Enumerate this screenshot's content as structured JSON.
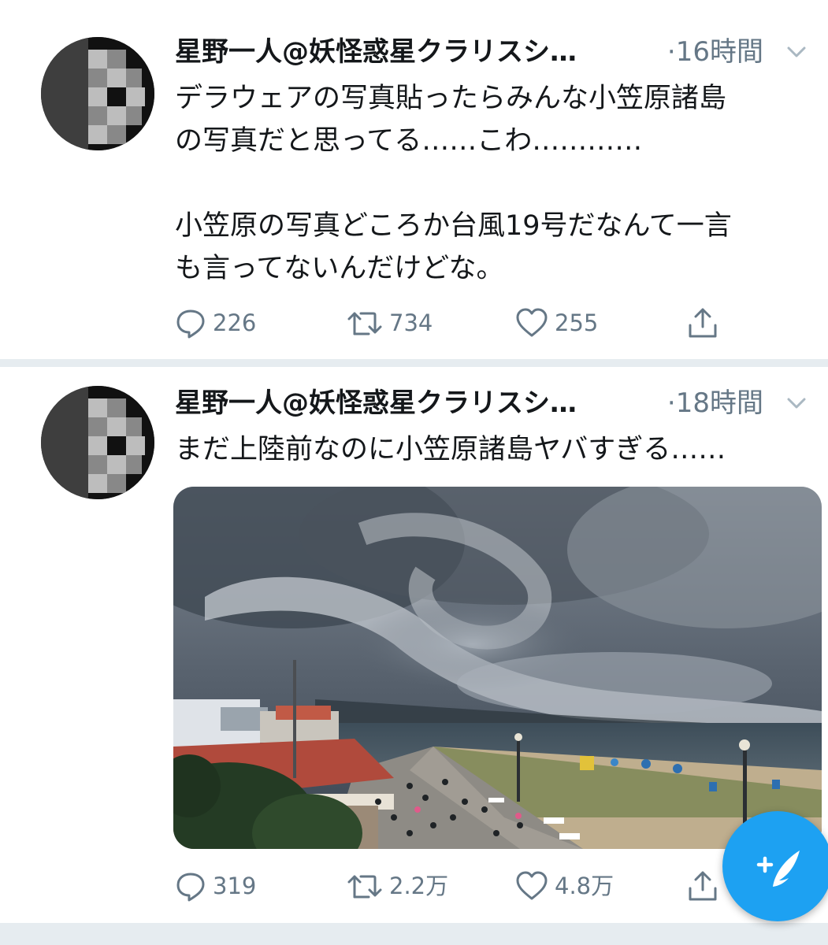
{
  "tweets": [
    {
      "author": "星野一人@妖怪惑星クラリスシ…",
      "time": "·16時間",
      "text": "デラウェアの写真貼ったらみんな小笠原諸島\nの写真だと思ってる……こわ…………\n\n小笠原の写真どころか台風19号だなんて一言\nも言ってないんだけどな。",
      "replies": "226",
      "retweets": "734",
      "likes": "255"
    },
    {
      "author": "星野一人@妖怪惑星クラリスシ…",
      "time": "·18時間",
      "text": "まだ上陸前なのに小笠原諸島ヤバすぎる……",
      "media": "storm-photo",
      "replies": "319",
      "retweets": "2.2万",
      "likes": "4.8万"
    }
  ],
  "compose_button": {
    "icon": "compose-tweet-icon",
    "color": "#1da1f2"
  },
  "colors": {
    "accent": "#1da1f2",
    "secondary_text": "#657786",
    "separator": "#e6ecf0"
  }
}
